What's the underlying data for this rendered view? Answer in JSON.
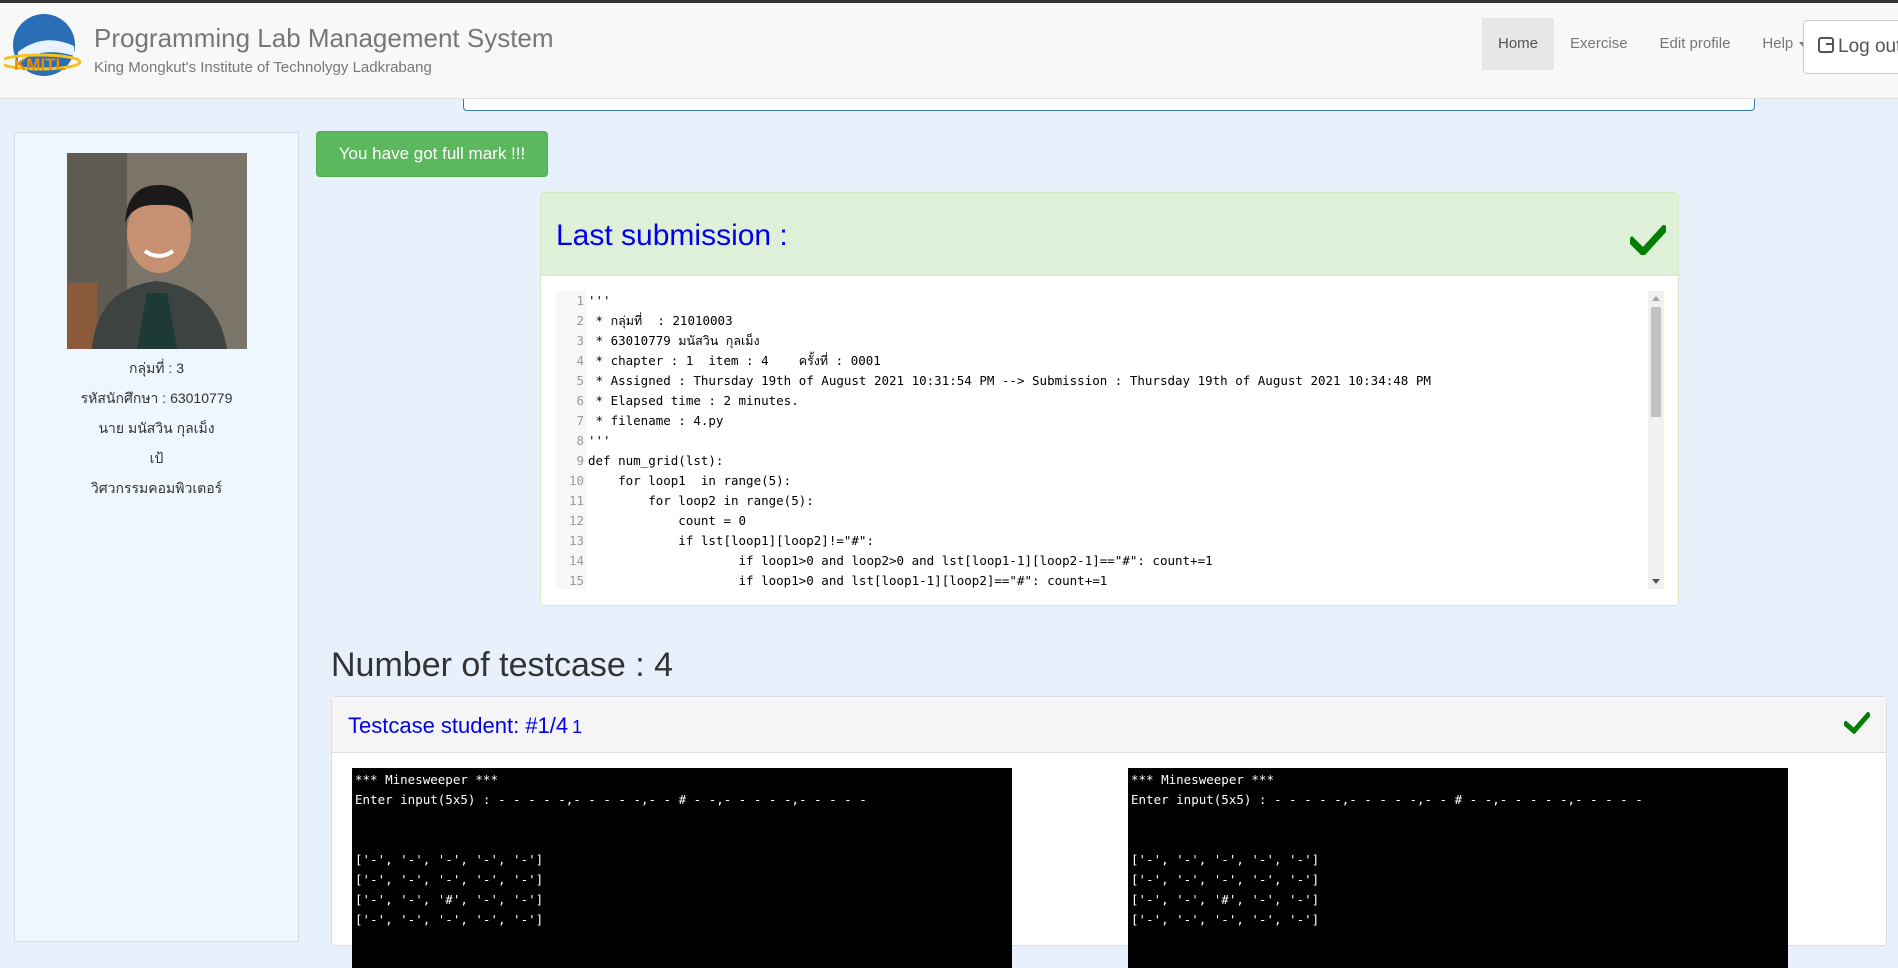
{
  "header": {
    "title": "Programming Lab Management System",
    "subtitle": "King Mongkut's Institute of Technolygy Ladkrabang",
    "logo_text": "KMITL",
    "nav": {
      "home": "Home",
      "exercise": "Exercise",
      "edit_profile": "Edit profile",
      "help": "Help",
      "logout": "Log out"
    }
  },
  "sidebar": {
    "group": "กลุ่มที่ : 3",
    "student_id": "รหัสนักศึกษา : 63010779",
    "name": "นาย มนัสวิน กุลเม็ง",
    "nickname": "เป้",
    "department": "วิศวกรรมคอมพิวเตอร์"
  },
  "alert": {
    "text": "You have got full mark !!!"
  },
  "submission": {
    "title": "Last submission :",
    "code_lines": [
      {
        "n": "1",
        "text": "'''"
      },
      {
        "n": "2",
        "text": " * กลุ่มที่  : 21010003"
      },
      {
        "n": "3",
        "text": " * 63010779 มนัสวิน กุลเม็ง"
      },
      {
        "n": "4",
        "text": " * chapter : 1  item : 4    ครั้งที่ : 0001"
      },
      {
        "n": "5",
        "text": " * Assigned : Thursday 19th of August 2021 10:31:54 PM --> Submission : Thursday 19th of August 2021 10:34:48 PM"
      },
      {
        "n": "6",
        "text": " * Elapsed time : 2 minutes."
      },
      {
        "n": "7",
        "text": " * filename : 4.py"
      },
      {
        "n": "8",
        "text": "'''"
      },
      {
        "n": "9",
        "text": "def num_grid(lst):"
      },
      {
        "n": "10",
        "text": "    for loop1  in range(5):"
      },
      {
        "n": "11",
        "text": "        for loop2 in range(5):"
      },
      {
        "n": "12",
        "text": "            count = 0"
      },
      {
        "n": "13",
        "text": "            if lst[loop1][loop2]!=\"#\":"
      },
      {
        "n": "14",
        "text": "                    if loop1>0 and loop2>0 and lst[loop1-1][loop2-1]==\"#\": count+=1"
      },
      {
        "n": "15",
        "text": "                    if loop1>0 and lst[loop1-1][loop2]==\"#\": count+=1"
      }
    ]
  },
  "testcases": {
    "count_label": "Number of testcase : 4",
    "panel_title": "Testcase student: #1/4",
    "panel_subtitle": "1",
    "left_console": [
      "*** Minesweeper ***",
      "Enter input(5x5) : - - - - -,- - - - -,- - # - -,- - - - -,- - - - -",
      "",
      "",
      "['-', '-', '-', '-', '-']",
      "['-', '-', '-', '-', '-']",
      "['-', '-', '#', '-', '-']",
      "['-', '-', '-', '-', '-']"
    ],
    "right_console": [
      "*** Minesweeper ***",
      "Enter input(5x5) : - - - - -,- - - - -,- - # - -,- - - - -,- - - - -",
      "",
      "",
      "['-', '-', '-', '-', '-']",
      "['-', '-', '-', '-', '-']",
      "['-', '-', '#', '-', '-']",
      "['-', '-', '-', '-', '-']"
    ]
  },
  "colors": {
    "success": "#5cb85c",
    "link_blue": "#0000ee",
    "check_green": "#008000",
    "panel_success_bg": "#dff0d8"
  }
}
